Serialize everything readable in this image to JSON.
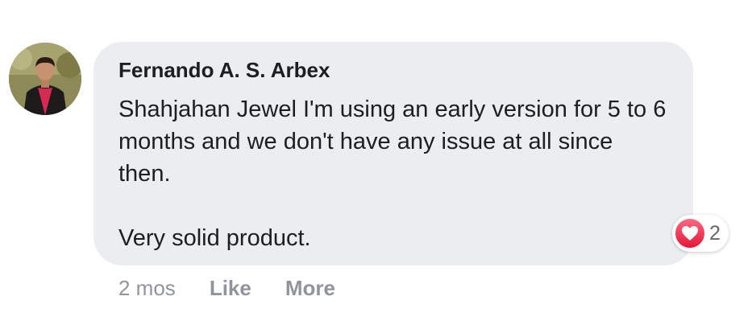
{
  "comment": {
    "author": "Fernando A. S. Arbex",
    "paragraphs": [
      "Shahjahan Jewel I'm using an early version for 5 to 6 months and we don't have any issue at all since then.",
      "Very solid product."
    ],
    "reactions": {
      "icon": "love-icon",
      "count": "2"
    },
    "timestamp": "2 mos",
    "actions": {
      "like": "Like",
      "more": "More"
    }
  },
  "colors": {
    "bubble": "#ebedf0",
    "text": "#1c1e21",
    "meta": "#90949c",
    "love": "#e61739"
  }
}
